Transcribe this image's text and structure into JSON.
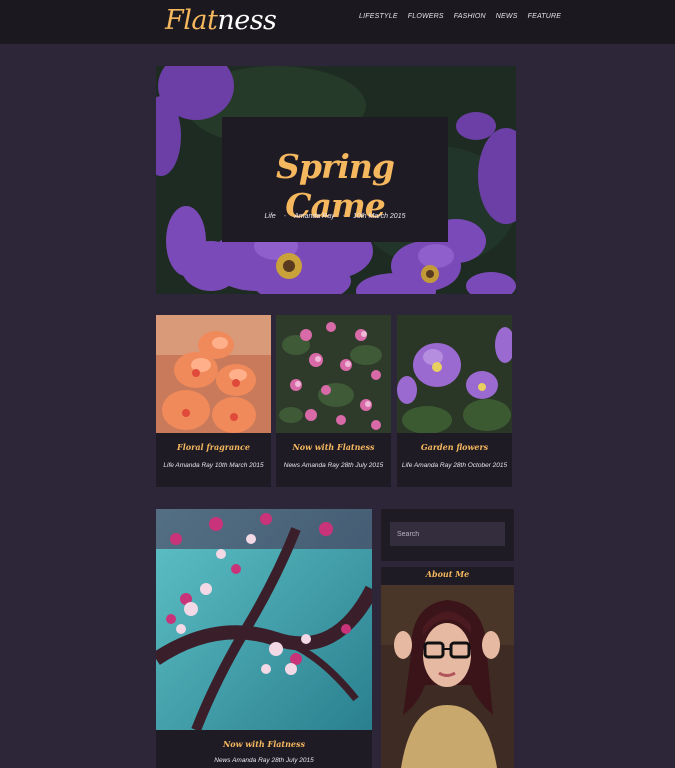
{
  "header": {
    "logo_part1": "Flat",
    "logo_part2": "ness",
    "nav": [
      "LIFESTYLE",
      "FLOWERS",
      "FASHION",
      "NEWS",
      "FEATURE"
    ]
  },
  "hero": {
    "title": "Spring Came",
    "category": "Life",
    "author": "Amanda Ray",
    "date": "10th March 2015"
  },
  "cards": [
    {
      "title": "Floral fragrance",
      "meta": "Life Amanda Ray 10th March 2015"
    },
    {
      "title": "Now with Flatness",
      "meta": "News Amanda Ray 28th July 2015"
    },
    {
      "title": "Garden flowers",
      "meta": "Life Amanda Ray 28th October 2015"
    }
  ],
  "featured": {
    "title": "Now with Flatness",
    "meta": "News Amanda Ray 28th July 2015"
  },
  "sidebar": {
    "search_placeholder": "Search",
    "about_title": "About Me"
  },
  "colors": {
    "accent": "#f5b85e",
    "page_bg": "#2d2638",
    "header_bg": "#1b1820",
    "card_bg": "#1f1b25"
  }
}
